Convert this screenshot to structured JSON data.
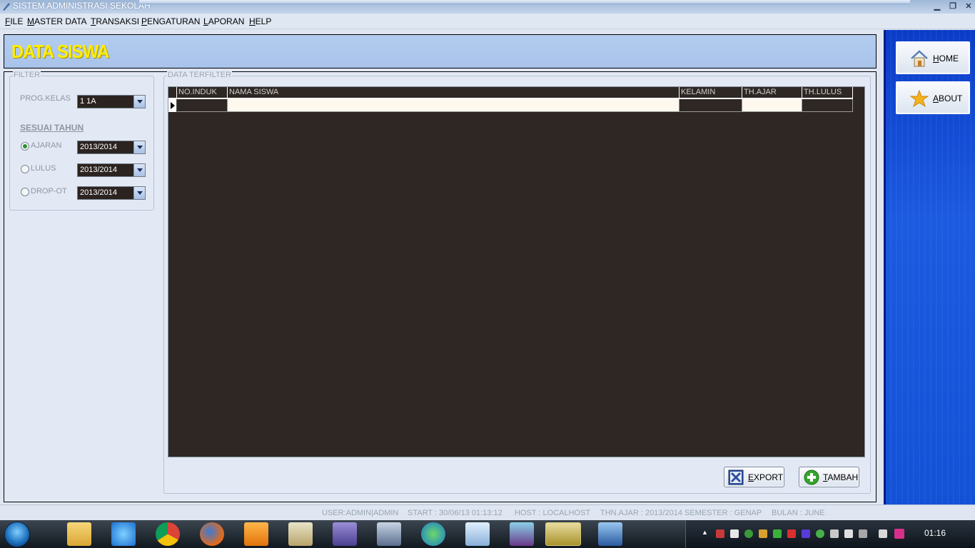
{
  "window": {
    "title": "SISTEM ADMINISTRASI SEKOLAH",
    "min": "▁",
    "restore": "❐",
    "close": "✕"
  },
  "menu": [
    {
      "u": "F",
      "rest": "ILE"
    },
    {
      "u": "M",
      "rest": "ASTER DATA"
    },
    {
      "u": "T",
      "rest": "RANSAKSI"
    },
    {
      "u": "P",
      "rest": "ENGATURAN"
    },
    {
      "u": "L",
      "rest": "APORAN"
    },
    {
      "u": "H",
      "rest": "ELP"
    }
  ],
  "page_title": "DATA SISWA",
  "filter": {
    "legend": "FILTER",
    "prog_kelas_label": "PROG.KELAS",
    "prog_kelas_value": "1 1A",
    "sesuai_label_1": "SESUAI",
    "sesuai_label_2": "TAHUN",
    "ajaran_label": "AJARAN",
    "ajaran_value": "2013/2014",
    "lulus_label": "LULUS",
    "lulus_value": "2013/2014",
    "dropout_label": "DROP-OT",
    "dropout_value": "2013/2014"
  },
  "data": {
    "legend": "DATA TERFILTER",
    "columns": [
      "NO.INDUK",
      "NAMA SISWA",
      "KELAMIN",
      "TH.AJAR",
      "TH.LULUS"
    ]
  },
  "buttons": {
    "export": {
      "u": "E",
      "rest": "XPORT"
    },
    "tambah": {
      "u": "T",
      "rest": "AMBAH"
    },
    "home": {
      "u": "H",
      "rest": "OME"
    },
    "about": {
      "u": "A",
      "rest": "BOUT"
    }
  },
  "status": {
    "user": "USER:ADMIN|ADMIN",
    "start": "START : 30/06/13 01:13:12",
    "host": "HOST : LOCALHOST",
    "thn": "THN.AJAR : 2013/2014 SEMESTER : GENAP",
    "bulan": "BULAN : JUNE"
  },
  "taskbar": {
    "clock": "01:16",
    "apps": [
      "windows-explorer-icon",
      "internet-explorer-icon",
      "chrome-icon",
      "firefox-icon",
      "media-player-icon",
      "notepad-icon",
      "presentation-icon",
      "windows-icon",
      "globe-icon",
      "eraser-icon",
      "winrar-icon",
      "media-classic-icon",
      "app-icon"
    ]
  }
}
